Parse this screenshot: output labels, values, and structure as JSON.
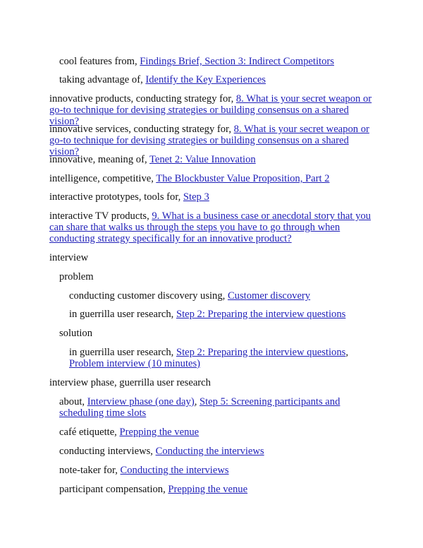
{
  "entries": [
    {
      "text": "cool features from, ",
      "links": [
        "Findings Brief, Section 3: Indirect Competitors"
      ]
    },
    {
      "text": "taking advantage of, ",
      "links": [
        "Identify the Key Experiences"
      ]
    },
    {
      "text": "innovative products, conducting strategy for, ",
      "links": [
        "8. What is your secret weapon or go-to technique for devising strategies or building consensus on a shared vision?"
      ]
    },
    {
      "text": "innovative services, conducting strategy for, ",
      "links": [
        "8. What is your secret weapon or go-to technique for devising strategies or building consensus on a shared vision?"
      ]
    },
    {
      "text": "innovative, meaning of, ",
      "links": [
        "Tenet 2: Value Innovation"
      ]
    },
    {
      "text": "intelligence, competitive, ",
      "links": [
        "The Blockbuster Value Proposition, Part 2"
      ]
    },
    {
      "text": "interactive prototypes, tools for, ",
      "links": [
        "Step 3"
      ]
    },
    {
      "text": "interactive TV products, ",
      "links": [
        "9. What is a business case or anecdotal story that you can share that walks us through the steps you have to go through when conducting strategy specifically for an innovative product?"
      ]
    },
    {
      "text": "interview",
      "links": []
    },
    {
      "text": "problem",
      "links": []
    },
    {
      "text": "conducting customer discovery using, ",
      "links": [
        "Customer discovery"
      ]
    },
    {
      "text": "in guerrilla user research, ",
      "links": [
        "Step 2: Preparing the interview questions"
      ]
    },
    {
      "text": "solution",
      "links": []
    },
    {
      "text": "in guerrilla user research, ",
      "links": [
        "Step 2: Preparing the interview questions",
        "Problem interview (10 minutes)"
      ]
    },
    {
      "text": "interview phase, guerrilla user research",
      "links": []
    },
    {
      "text": "about, ",
      "links": [
        "Interview phase (one day)",
        "Step 5: Screening participants and scheduling time slots"
      ]
    },
    {
      "text": "café etiquette, ",
      "links": [
        "Prepping the venue"
      ]
    },
    {
      "text": "conducting interviews, ",
      "links": [
        "Conducting the interviews"
      ]
    },
    {
      "text": "note-taker for, ",
      "links": [
        "Conducting the interviews"
      ]
    },
    {
      "text": "participant compensation, ",
      "links": [
        "Prepping the venue"
      ]
    }
  ],
  "separator": ", "
}
